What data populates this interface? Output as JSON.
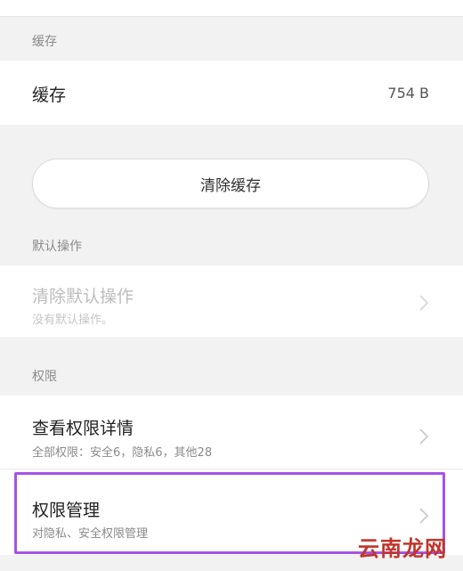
{
  "cache_section": {
    "header": "缓存",
    "row_title": "缓存",
    "row_value": "754 B",
    "clear_button_label": "清除缓存"
  },
  "default_section": {
    "header": "默认操作",
    "row_title": "清除默认操作",
    "row_subtitle": "没有默认操作。"
  },
  "permission_section": {
    "header": "权限",
    "details_title": "查看权限详情",
    "details_subtitle": "全部权限：安全6，隐私6，其他28",
    "manage_title": "权限管理",
    "manage_subtitle": "对隐私、安全权限管理"
  },
  "icons": {
    "chevron": "chevron-right-icon"
  },
  "colors": {
    "highlight": "#a653e6",
    "watermark": "#c0352b"
  },
  "watermark": "云南龙网"
}
